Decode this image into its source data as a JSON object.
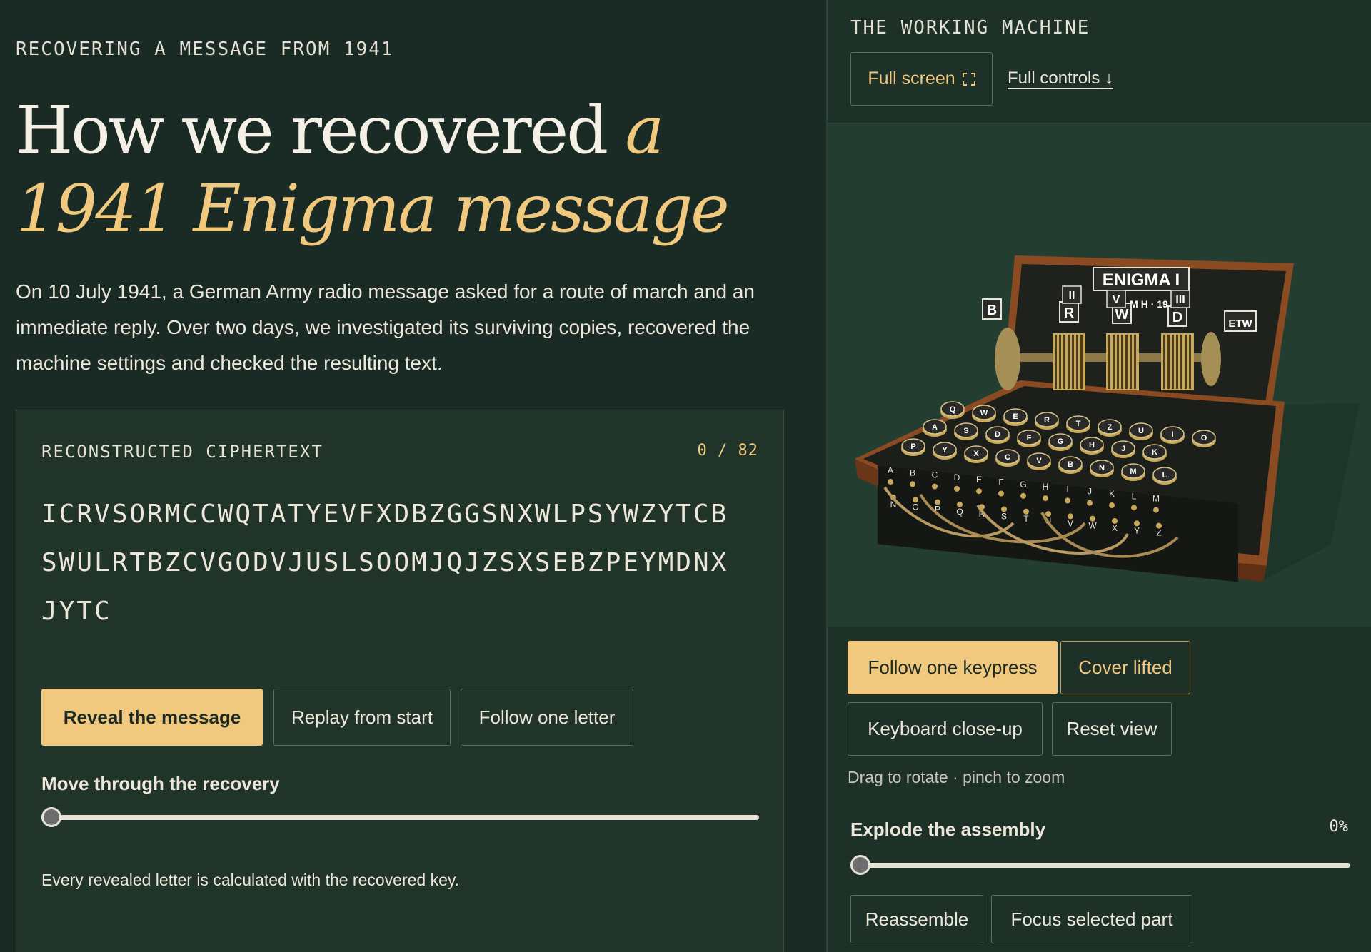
{
  "article": {
    "eyebrow": "RECOVERING A MESSAGE FROM 1941",
    "headline_plain": "How we recovered ",
    "headline_accent": "a 1941 Enigma message",
    "intro": "On 10 July 1941, a German Army radio message asked for a route of march and an immediate reply. Over two days, we investigated its surviving copies, recovered the machine settings and checked the resulting text."
  },
  "cipher_panel": {
    "label": "RECONSTRUCTED CIPHERTEXT",
    "counter": "0 / 82",
    "lines": [
      "ICRVSORMCCWQTATYEVFXDBZGGSNXWLPSYWZYTCB",
      "SWULRTBZCVGODVJUSLSOOMJQJZSXSEBZPEYMDNX",
      "JYTC"
    ],
    "buttons": {
      "reveal": "Reveal the message",
      "replay": "Replay from start",
      "follow_letter": "Follow one letter"
    },
    "slider_label": "Move through the recovery",
    "slider_progress": 0,
    "note": "Every revealed letter is calculated with the recovered key."
  },
  "machine_panel": {
    "eyebrow": "THE WORKING MACHINE",
    "full_screen": "Full screen",
    "full_controls": "Full controls",
    "model": {
      "title": "ENIGMA I",
      "rotor_labels": [
        "B",
        "R",
        "W",
        "D",
        "ETW"
      ],
      "rotor_numerals": [
        "II",
        "V",
        "III"
      ],
      "plate_text": "M  H · 19",
      "key_rows": [
        [
          "Q",
          "W",
          "E",
          "R",
          "T",
          "Z",
          "U",
          "I",
          "O"
        ],
        [
          "A",
          "S",
          "D",
          "F",
          "G",
          "H",
          "J",
          "K"
        ],
        [
          "P",
          "Y",
          "X",
          "C",
          "V",
          "B",
          "N",
          "M",
          "L"
        ]
      ],
      "plugboard_row1": [
        "A",
        "B",
        "C",
        "D",
        "E",
        "F",
        "G",
        "H",
        "I",
        "J",
        "K",
        "L",
        "M"
      ],
      "plugboard_row2": [
        "N",
        "O",
        "P",
        "Q",
        "R",
        "S",
        "T",
        "U",
        "V",
        "W",
        "X",
        "Y",
        "Z"
      ],
      "colors": {
        "wood": "#8a4a22",
        "panel": "#1e211c",
        "brass": "#c8a85a",
        "key_top": "#2a2b28",
        "lamp": "#d9c58a"
      }
    },
    "buttons": {
      "follow_keypress": "Follow one keypress",
      "cover_lifted": "Cover lifted",
      "keyboard_closeup": "Keyboard close-up",
      "reset_view": "Reset view"
    },
    "hint": "Drag to rotate · pinch to zoom",
    "explode_label": "Explode the assembly",
    "explode_value": "0%",
    "explode_progress": 0,
    "bottom_buttons": {
      "reassemble": "Reassemble",
      "focus_part": "Focus selected part"
    }
  }
}
